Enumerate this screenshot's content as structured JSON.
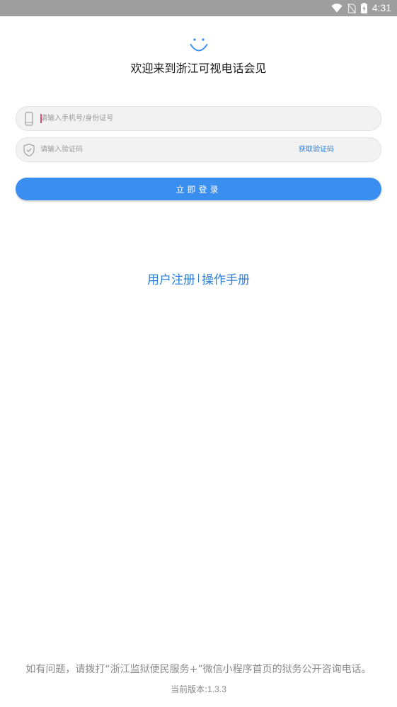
{
  "status_bar": {
    "time": "4:31",
    "icons": [
      "wifi-icon",
      "no-sim-icon",
      "battery-charging-icon"
    ]
  },
  "header": {
    "logo_icon": "smiley-face-icon",
    "title": "欢迎来到浙江可视电话会见"
  },
  "form": {
    "phone": {
      "icon": "phone-icon",
      "placeholder": "请输入手机号/身份证号",
      "value": ""
    },
    "code": {
      "icon": "shield-icon",
      "placeholder": "请输入验证码",
      "value": "",
      "get_code_label": "获取验证码"
    },
    "login_label": "立即登录"
  },
  "links": {
    "register": "用户注册",
    "manual": "操作手册"
  },
  "footer": {
    "note": "如有问题，请拨打“浙江监狱便民服务+”微信小程序首页的狱务公开咨询电话。",
    "version_label": "当前版本:",
    "version": "1.3.3"
  },
  "colors": {
    "status_bar": "#9e9e9e",
    "primary": "#3a8ef0",
    "link": "#2f7fd8",
    "field_bg": "#f2f2f2",
    "muted_text": "#8a8a8a"
  }
}
